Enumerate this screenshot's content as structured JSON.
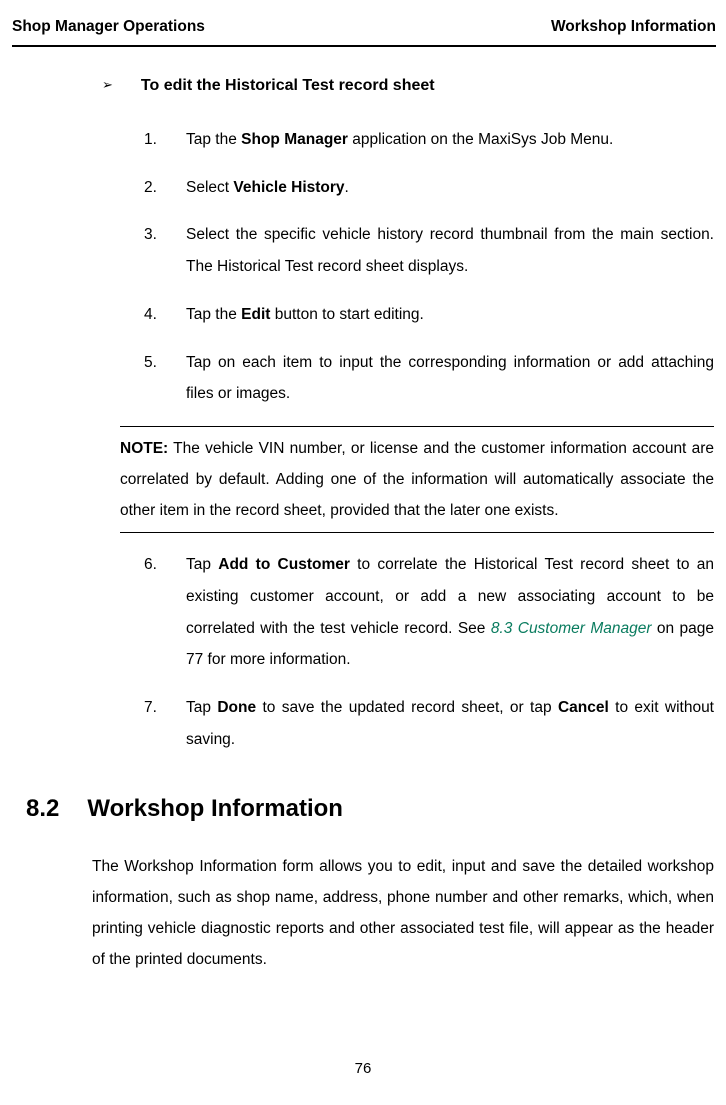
{
  "header": {
    "left": "Shop Manager Operations",
    "right": "Workshop Information"
  },
  "instruction_heading": "To edit the Historical Test record sheet",
  "note": {
    "label": "NOTE:",
    "text": " The vehicle VIN number, or license and the customer information account are correlated by default. Adding one of the information will automatically associate the other item in the record sheet, provided that the later one exists."
  },
  "steps": {
    "s1_a": "Tap the ",
    "s1_b": "Shop Manager",
    "s1_c": " application on the MaxiSys Job Menu.",
    "s2_a": "Select ",
    "s2_b": "Vehicle History",
    "s2_c": ".",
    "s3": "Select the specific vehicle history record thumbnail from the main section. The Historical Test record sheet displays.",
    "s4_a": "Tap the ",
    "s4_b": "Edit",
    "s4_c": " button to start editing.",
    "s5": "Tap on each item to input the corresponding information or add attaching files or images.",
    "s6_a": "Tap ",
    "s6_b": "Add to Customer",
    "s6_c": " to correlate the Historical Test record sheet to an existing customer account, or add a new associating account to be correlated with the test vehicle record. See ",
    "s6_link": "8.3 Customer Manager",
    "s6_d": " on page 77 for more information.",
    "s7_a": "Tap ",
    "s7_b": "Done",
    "s7_c": " to save the updated record sheet, or tap ",
    "s7_d": "Cancel",
    "s7_e": " to exit without saving."
  },
  "section": {
    "number": "8.2",
    "title": "Workshop Information",
    "body": "The Workshop Information form allows you to edit, input and save the detailed workshop information, such as shop name, address, phone number and other remarks, which, when printing vehicle diagnostic reports and other associated test file, will appear as the header of the printed documents."
  },
  "page_number": "76"
}
